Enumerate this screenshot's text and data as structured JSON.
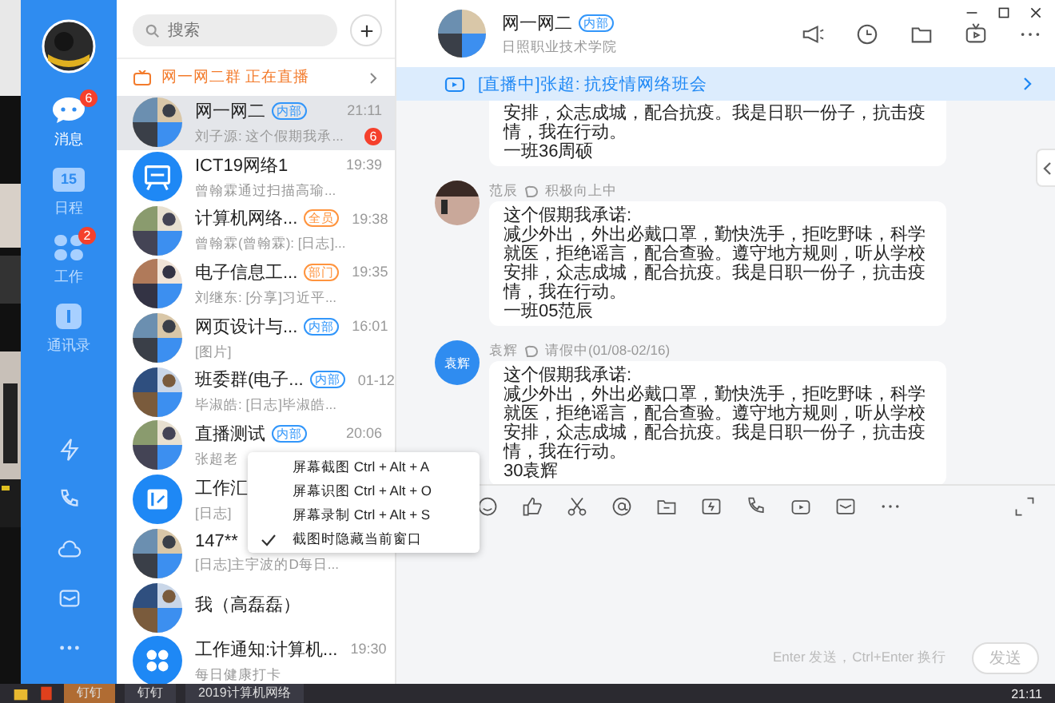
{
  "nav": {
    "items": [
      {
        "label": "消息",
        "badge": "6",
        "selected": true
      },
      {
        "label": "日程",
        "glyph": "15",
        "selected": false
      },
      {
        "label": "工作",
        "badge": "2",
        "selected": false
      },
      {
        "label": "通讯录",
        "selected": false
      }
    ]
  },
  "search": {
    "placeholder": "搜索"
  },
  "live_notice": "网一网二群 正在直播",
  "conversations": [
    {
      "title": "网一网二",
      "tag": {
        "text": "内部",
        "color": "#3296fa"
      },
      "time": "21:11",
      "preview": "刘子源: 这个假期我承...",
      "unread": "6",
      "selected": true
    },
    {
      "title": "ICT19网络1",
      "time": "19:39",
      "preview": "曾翰霖通过扫描高瑜...",
      "kind": "icon",
      "selected": false
    },
    {
      "title": "计算机网络...",
      "tag": {
        "text": "全员",
        "color": "#ff943e"
      },
      "time": "19:38",
      "preview": "曾翰霖(曾翰霖): [日志]...",
      "selected": false
    },
    {
      "title": "电子信息工...",
      "tag": {
        "text": "部门",
        "color": "#ff943e"
      },
      "time": "19:35",
      "preview": "刘继东: [分享]习近平...",
      "selected": false
    },
    {
      "title": "网页设计与...",
      "tag": {
        "text": "内部",
        "color": "#3296fa"
      },
      "time": "16:01",
      "preview": "[图片]",
      "selected": false
    },
    {
      "title": "班委群(电子...",
      "tag": {
        "text": "内部",
        "color": "#3296fa"
      },
      "time": "01-12",
      "preview": "毕淑皓: [日志]毕淑皓...",
      "selected": false
    },
    {
      "title": "直播测试",
      "tag": {
        "text": "内部",
        "color": "#3296fa"
      },
      "time": "20:06",
      "preview": "张超老",
      "selected": false
    },
    {
      "title": "工作汇",
      "preview": "[日志]",
      "kind": "icon",
      "selected": false
    },
    {
      "title": "147**",
      "preview": "[日志]主宇波的D每日...",
      "selected": false
    },
    {
      "title": "我（高磊磊）",
      "selected": false
    },
    {
      "title": "工作通知:计算机...",
      "time": "19:30",
      "preview": "每日健康打卡",
      "kind": "icon",
      "selected": false
    }
  ],
  "menu": [
    {
      "label": "屏幕截图 Ctrl + Alt + A",
      "checked": false
    },
    {
      "label": "屏幕识图 Ctrl + Alt + O",
      "checked": false
    },
    {
      "label": "屏幕录制 Ctrl + Alt + S",
      "checked": false
    },
    {
      "label": "截图时隐藏当前窗口",
      "checked": true
    }
  ],
  "chat": {
    "title": "网一网二",
    "tag": {
      "text": "内部",
      "color": "#3296fa"
    },
    "subtitle": "日照职业技术学院",
    "banner": "[直播中]张超: 抗疫情网络班会",
    "messages": [
      {
        "text": "安排，众志成城，配合抗疫。我是日职一份子，抗击疫情，我在行动。",
        "signature": "一班36周硕"
      },
      {
        "sender": "范辰",
        "status": "积极向上中",
        "heading": "这个假期我承诺:",
        "text": "减少外出，外出必戴口罩，勤快洗手，拒吃野味，科学就医，拒绝谣言，配合查验。遵守地方规则，听从学校安排，众志成城，配合抗疫。我是日职一份子，抗击疫情，我在行动。",
        "signature": "一班05范辰"
      },
      {
        "sender": "袁辉",
        "status": "请假中(01/08-02/16)",
        "kind": "text",
        "avatar_text": "袁辉",
        "heading": "这个假期我承诺:",
        "text": "减少外出，外出必戴口罩，勤快洗手，拒吃野味，科学就医，拒绝谣言，配合查验。遵守地方规则，听从学校安排，众志成城，配合抗疫。我是日职一份子，抗击疫情，我在行动。",
        "signature": "30袁辉"
      }
    ],
    "hint": "Enter 发送，Ctrl+Enter 换行",
    "send": "发送"
  },
  "taskbar": {
    "apps": [
      "钉钉",
      "钉钉",
      "2019计算机网络"
    ],
    "clock": "21:11"
  }
}
